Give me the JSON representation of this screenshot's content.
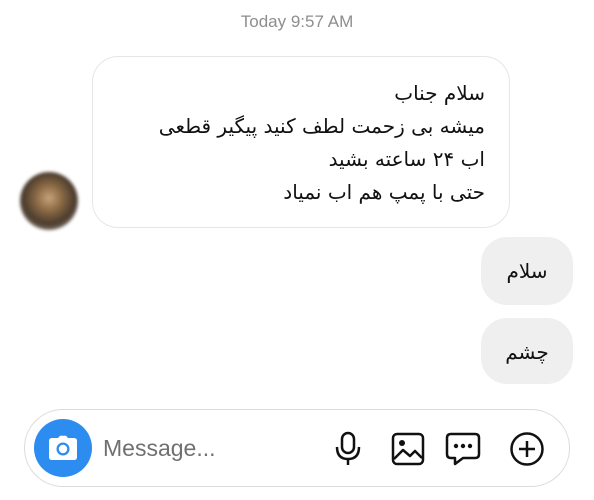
{
  "header": {
    "timestamp": "Today 9:57 AM"
  },
  "messages": {
    "incoming": {
      "lines": [
        "سلام جناب",
        "میشه بی زحمت لطف کنید پیگیر قطعی",
        "اب ۲۴ ساعته بشید",
        "حتی با پمپ هم اب نمیاد"
      ]
    },
    "outgoing": [
      {
        "text": "سلام"
      },
      {
        "text": "چشم"
      }
    ]
  },
  "composer": {
    "placeholder": "Message...",
    "icons": [
      "camera-icon",
      "microphone-icon",
      "gallery-icon",
      "sticker-icon",
      "add-icon"
    ]
  },
  "colors": {
    "accent": "#2d8cf0",
    "bubble_out": "#efefef",
    "timestamp": "#8e8e8e"
  }
}
